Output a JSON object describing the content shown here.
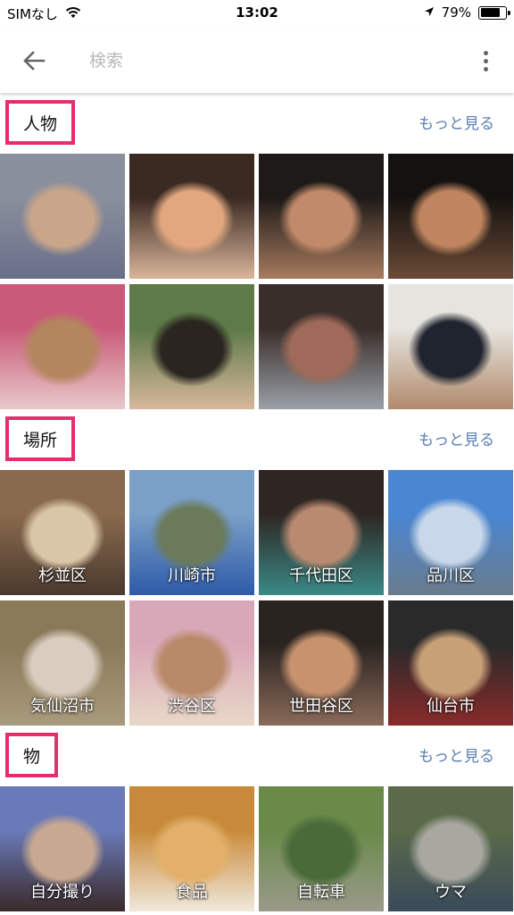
{
  "status_bar": {
    "carrier": "SIMなし",
    "time": "13:02",
    "battery": "79%",
    "battery_level": 0.79
  },
  "app_bar": {
    "search_placeholder": "検索"
  },
  "sections": [
    {
      "title": "人物",
      "more": "もっと見る",
      "tiles": [
        {
          "label": "",
          "colors": [
            "#8a8f9c",
            "#c9a58a",
            "#6a6f8a"
          ]
        },
        {
          "label": "",
          "colors": [
            "#3b2a22",
            "#e2a77f",
            "#d9b59a"
          ]
        },
        {
          "label": "",
          "colors": [
            "#1e1a18",
            "#c18a6a",
            "#a77c5f"
          ]
        },
        {
          "label": "",
          "colors": [
            "#141210",
            "#c08560",
            "#6b4a37"
          ]
        },
        {
          "label": "",
          "colors": [
            "#c95a7a",
            "#b3865f",
            "#e8c9c9"
          ]
        },
        {
          "label": "",
          "colors": [
            "#5d7a48",
            "#2a2520",
            "#d7b79c"
          ]
        },
        {
          "label": "",
          "colors": [
            "#3a2e2a",
            "#a06a5a",
            "#9aa0a8"
          ]
        },
        {
          "label": "",
          "colors": [
            "#e6e4df",
            "#20242e",
            "#b08a6c"
          ]
        }
      ]
    },
    {
      "title": "場所",
      "more": "もっと見る",
      "tiles": [
        {
          "label": "杉並区",
          "colors": [
            "#8a6a4e",
            "#d9c6a8",
            "#4a3a2e"
          ]
        },
        {
          "label": "川崎市",
          "colors": [
            "#7aa0c8",
            "#6a7a5a",
            "#2e5aa8"
          ]
        },
        {
          "label": "千代田区",
          "colors": [
            "#2e2622",
            "#b98a70",
            "#3a8a88"
          ]
        },
        {
          "label": "品川区",
          "colors": [
            "#4a86d2",
            "#c8d8ea",
            "#6a7c8c"
          ]
        },
        {
          "label": "気仙沼市",
          "colors": [
            "#8a7a5a",
            "#d8cdbf",
            "#a89a7c"
          ]
        },
        {
          "label": "渋谷区",
          "colors": [
            "#d9a8b8",
            "#b88a6a",
            "#e8d8c8"
          ]
        },
        {
          "label": "世田谷区",
          "colors": [
            "#2a2420",
            "#c8926e",
            "#8a6a5a"
          ]
        },
        {
          "label": "仙台市",
          "colors": [
            "#2a2a2a",
            "#c8a078",
            "#8a2a2a"
          ]
        }
      ]
    },
    {
      "title": "物",
      "more": "もっと見る",
      "tiles": [
        {
          "label": "自分撮り",
          "colors": [
            "#6a7ab8",
            "#c8a890",
            "#3a2a2a"
          ]
        },
        {
          "label": "食品",
          "colors": [
            "#c88a3a",
            "#e2b06a",
            "#f0e8dc"
          ]
        },
        {
          "label": "自転車",
          "colors": [
            "#6a8a4a",
            "#4a6a3a",
            "#9a9a8a"
          ]
        },
        {
          "label": "ウマ",
          "colors": [
            "#5a6a4a",
            "#a8a8a0",
            "#3a4a5a"
          ]
        }
      ]
    }
  ]
}
